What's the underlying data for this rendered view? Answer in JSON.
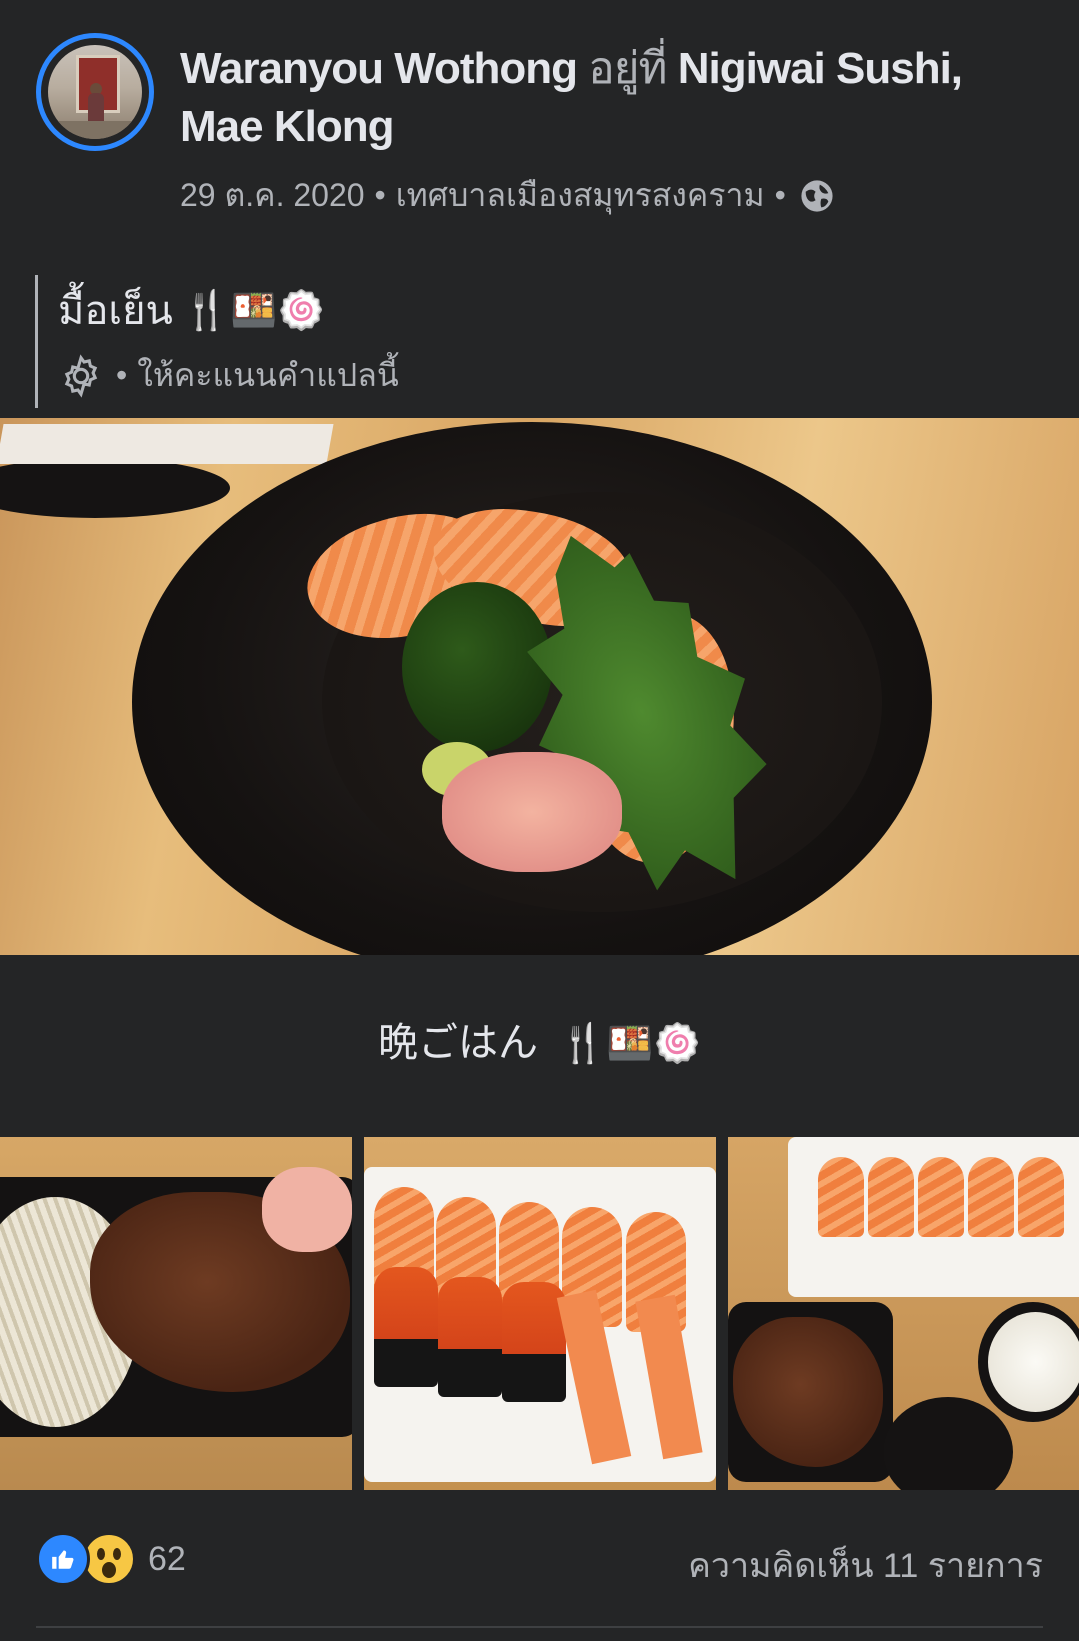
{
  "post": {
    "author": "Waranyou Wothong",
    "at_text": "อยู่ที่",
    "place": "Nigiwai Sushi, Mae Klong",
    "date": "29 ต.ค. 2020",
    "location": "เทศบาลเมืองสมุทรสงคราม",
    "separator": "•",
    "privacy_icon": "globe-icon"
  },
  "caption": {
    "text": "มื้อเย็น",
    "emojis": "🍴🍱🍥",
    "translate_label": "ให้คะแนนคำแปลนี้",
    "translate_icon": "gear-icon"
  },
  "caption2": {
    "text": "晩ごはん",
    "emojis": "🍴🍱🍥"
  },
  "footer": {
    "reaction_icons": [
      "like-icon",
      "wow-icon"
    ],
    "reaction_count": "62",
    "comments_label": "ความคิดเห็น 11 รายการ"
  },
  "colors": {
    "background": "#242526",
    "primary_text": "#e4e6eb",
    "secondary_text": "#b0b3b8",
    "accent": "#2d88ff"
  }
}
